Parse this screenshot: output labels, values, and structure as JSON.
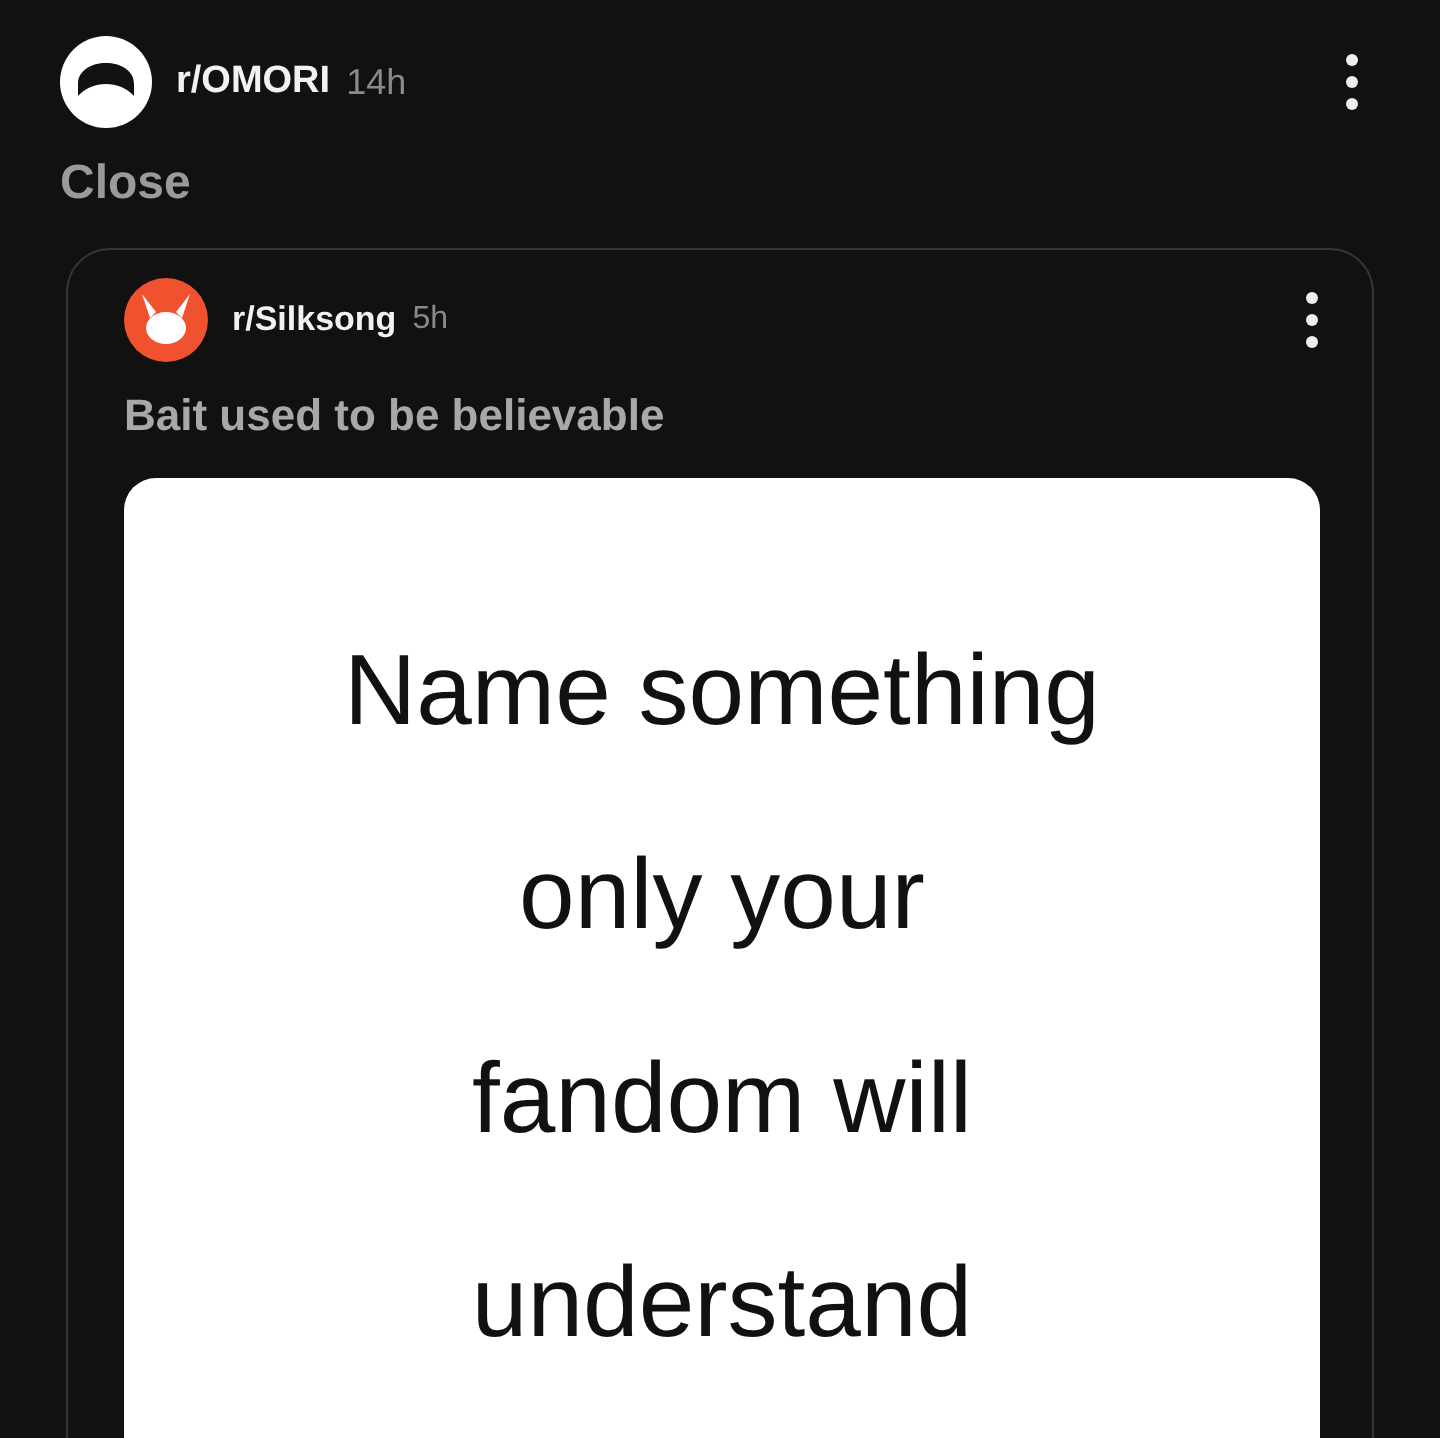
{
  "post": {
    "community": "r/OMORI",
    "time": "14h",
    "close_label": "Close"
  },
  "crosspost": {
    "community": "r/Silksong",
    "time": "5h",
    "title": "Bait used to be believable",
    "image_lines": [
      "Name something",
      "only your",
      "fandom will",
      "understand"
    ]
  }
}
